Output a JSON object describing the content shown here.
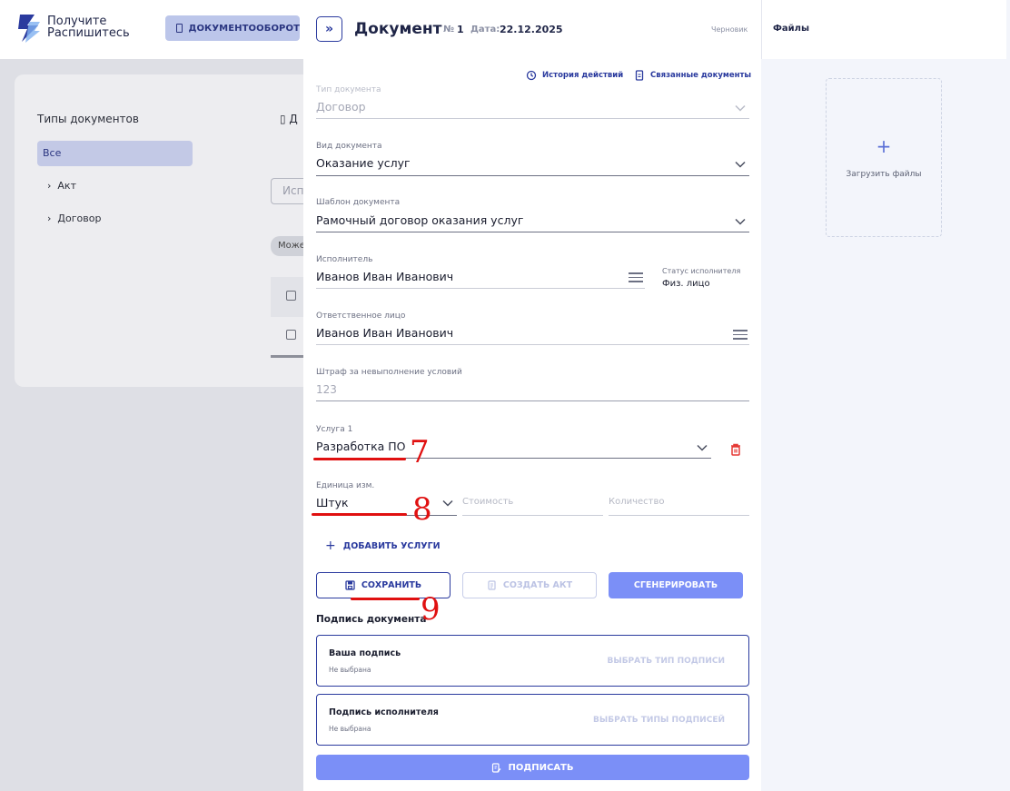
{
  "brand": {
    "logo_line1": "Получите",
    "logo_line2": "Распишитесь",
    "nav_button": "ДОКУМЕНТООБОРОТ"
  },
  "sidebar": {
    "title": "Типы документов",
    "items": [
      {
        "label": "Все",
        "selected": true
      },
      {
        "label": "Акт"
      },
      {
        "label": "Договор"
      }
    ],
    "peek_heading": "Д",
    "peek_input": "Исп",
    "peek_chip": "Може"
  },
  "document": {
    "title": "Документ",
    "number_label": "№",
    "number": "1",
    "date_label": "Дата:",
    "date": "22.12.2025",
    "status": "Черновик",
    "history_link": "История действий",
    "related_link": "Связанные документы",
    "fields": {
      "doc_type": {
        "label": "Тип документа",
        "value": "Договор"
      },
      "doc_kind": {
        "label": "Вид документа",
        "value": "Оказание услуг"
      },
      "template": {
        "label": "Шаблон документа",
        "value": "Рамочный договор оказания услуг"
      },
      "executor": {
        "label": "Исполнитель",
        "value": "Иванов Иван Иванович"
      },
      "executor_status": {
        "label": "Статус исполнителя",
        "value": "Физ. лицо"
      },
      "responsible": {
        "label": "Ответственное лицо",
        "value": "Иванов Иван Иванович"
      },
      "penalty": {
        "label": "Штраф за невыполнение условий",
        "value": "123"
      },
      "service1": {
        "label": "Услуга 1",
        "value": "Разработка ПО"
      },
      "unit": {
        "label": "Единица изм.",
        "value": "Штук"
      },
      "cost_placeholder": "Стоимость",
      "quantity_placeholder": "Количество"
    },
    "add_service": "ДОБАВИТЬ УСЛУГИ",
    "buttons": {
      "save": "СОХРАНИТЬ",
      "create_act": "СОЗДАТЬ АКТ",
      "generate": "СГЕНЕРИРОВАТЬ"
    },
    "signature": {
      "title": "Подпись документа",
      "yours": {
        "name": "Ваша подпись",
        "state": "Не выбрана",
        "action": "ВЫБРАТЬ ТИП ПОДПИСИ"
      },
      "executor": {
        "name": "Подпись исполнителя",
        "state": "Не выбрана",
        "action": "ВЫБРАТЬ ТИПЫ ПОДПИСЕЙ"
      },
      "sign_button": "ПОДПИСАТЬ"
    }
  },
  "files": {
    "title": "Файлы",
    "upload_label": "Загрузить файлы"
  },
  "annotations": [
    "7",
    "8",
    "9"
  ],
  "colors": {
    "accent": "#2a3a9e",
    "primary_button": "#7b8ff7",
    "annotation": "#e01010",
    "delete": "#e53935"
  }
}
